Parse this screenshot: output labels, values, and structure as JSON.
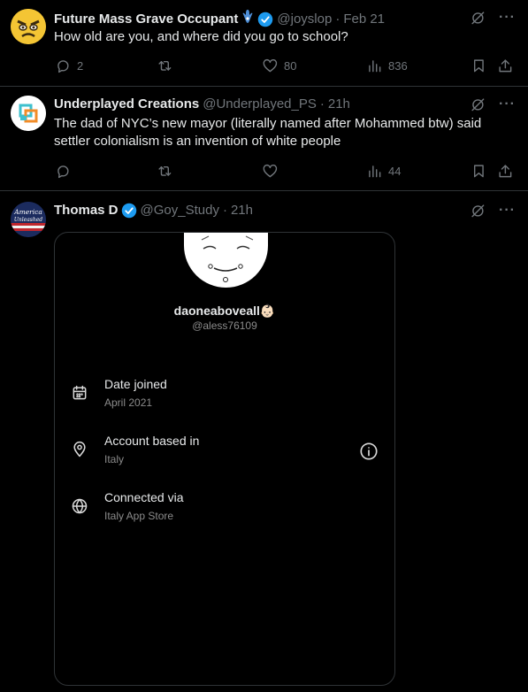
{
  "tweets": [
    {
      "name": "Future Mass Grave Occupant",
      "handle": "@joyslop",
      "sep": "·",
      "time": "Feb 21",
      "text": "How old are you, and where did you go to school?",
      "replies": "2",
      "retweets": "",
      "likes": "80",
      "views": "836"
    },
    {
      "name": "Underplayed Creations",
      "handle": "@Underplayed_PS",
      "sep": "·",
      "time": "21h",
      "text": "The dad of NYC’s new mayor (literally named after Mohammed btw) said settler colonialism is an invention of white people",
      "replies": "",
      "retweets": "",
      "likes": "",
      "views": "44"
    },
    {
      "name": "Thomas D",
      "handle": "@Goy_Study",
      "sep": "·",
      "time": "21h",
      "avatar_text_1": "America",
      "avatar_text_2": "Unleashed"
    }
  ],
  "card": {
    "profile_name": "daoneaboveall",
    "profile_emoji": "👶🏻",
    "profile_handle": "@aless76109",
    "rows": [
      {
        "label": "Date joined",
        "value": "April 2021",
        "icon": "calendar-icon"
      },
      {
        "label": "Account based in",
        "value": "Italy",
        "icon": "location-pin-icon"
      },
      {
        "label": "Connected via",
        "value": "Italy App Store",
        "icon": "globe-icon"
      }
    ]
  },
  "colors": {
    "background": "#000000",
    "text": "#e7e9ea",
    "muted": "#71767b",
    "verified": "#1d9bf0",
    "divider": "#2f3336"
  }
}
